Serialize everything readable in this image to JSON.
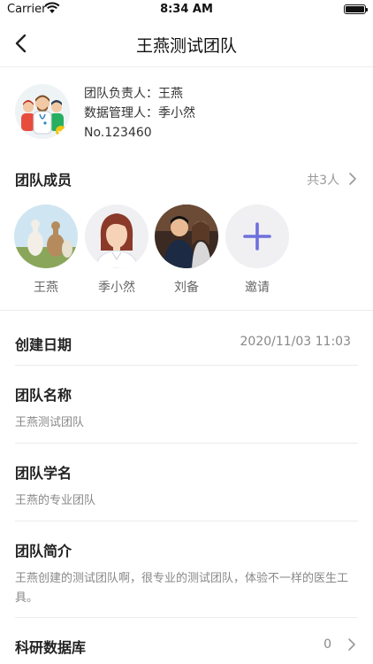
{
  "status": {
    "carrier": "Carrier",
    "time": "8:34 AM"
  },
  "nav": {
    "title": "王燕测试团队",
    "back_icon": "chevron-left-icon"
  },
  "team": {
    "leader": "团队负责人：王燕",
    "data_manager": "数据管理人：季小然",
    "number": "No.123460"
  },
  "members_section": {
    "title": "团队成员",
    "count": "共3人",
    "members": [
      {
        "name": "王燕"
      },
      {
        "name": "季小然"
      },
      {
        "name": "刘备"
      },
      {
        "name": "邀请"
      }
    ]
  },
  "details": {
    "created": {
      "label": "创建日期",
      "value": "2020/11/03 11:03"
    },
    "name": {
      "label": "团队名称",
      "value": "王燕测试团队"
    },
    "scientific_name": {
      "label": "团队学名",
      "value": "王燕的专业团队"
    },
    "intro": {
      "label": "团队简介",
      "value": "王燕创建的测试团队啊，很专业的测试团队，体验不一样的医生工具。"
    },
    "database": {
      "label": "科研数据库",
      "value": "0"
    }
  },
  "colors": {
    "accent": "#6f6fdc",
    "divider": "#ececec",
    "muted": "#888888"
  }
}
